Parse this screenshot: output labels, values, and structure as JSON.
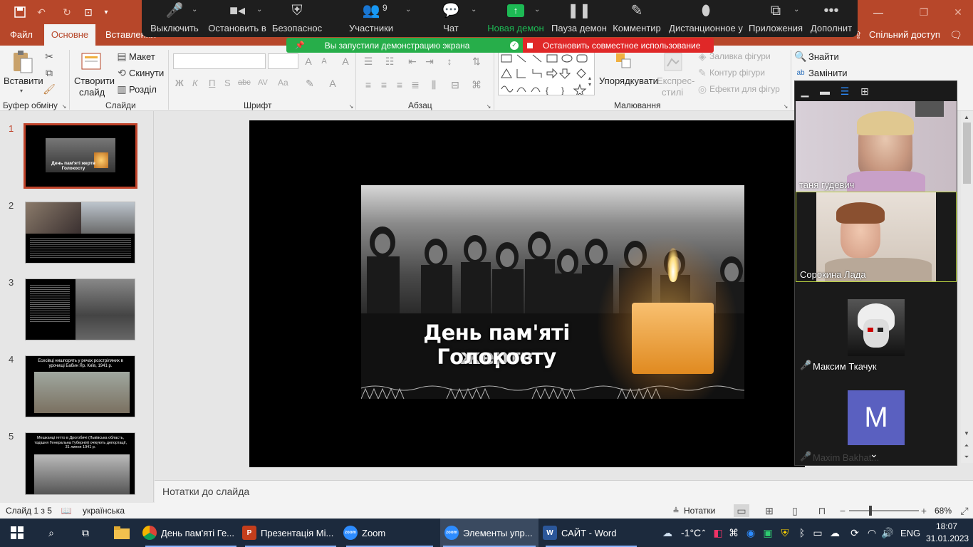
{
  "titlebar": {
    "hidden_right_text": "",
    "window_controls": [
      "minimize-icon",
      "restore-icon",
      "close-icon"
    ]
  },
  "tabs": {
    "file": "Файл",
    "home": "Основне",
    "insert": "Вставлення",
    "share": "Спільний доступ"
  },
  "ribbon": {
    "clipboard": {
      "paste": "Вставити",
      "label": "Буфер обміну"
    },
    "slides": {
      "new_slide": "Створити",
      "new_slide2": "слайд",
      "layout": "Макет",
      "reset": "Скинути",
      "section": "Розділ",
      "label": "Слайди"
    },
    "font": {
      "label": "Шрифт",
      "bold": "Ж",
      "italic": "К",
      "underline": "П",
      "shadow": "S",
      "strike": "abc",
      "spacing": "AV",
      "case": "Aa"
    },
    "paragraph": {
      "label": "Абзац"
    },
    "drawing": {
      "arrange": "Упорядкувати",
      "quick_styles": "Експрес-",
      "quick_styles2": "стилі",
      "fill": "Заливка фігури",
      "outline": "Контур фігури",
      "effects": "Ефекти для фігур",
      "label": "Малювання"
    },
    "editing": {
      "find": "Знайти",
      "replace": "Замінити"
    }
  },
  "zoom_toolbar": {
    "mute": "Выключить",
    "video": "Остановить в",
    "security": "Безопаснос",
    "participants": "Участники",
    "participants_count": "9",
    "chat": "Чат",
    "new_share": "Новая демон",
    "pause_share": "Пауза демон",
    "annotate": "Комментир",
    "remote": "Дистанционное у",
    "apps": "Приложения",
    "more": "Дополнит"
  },
  "share_banner": {
    "sharing": "Вы запустили демонстрацию экрана",
    "stop": "Остановить совместное использование"
  },
  "slides_panel": {
    "thumbs": [
      {
        "num": "1",
        "caption": "День пам'яті жертв Голокосту"
      },
      {
        "num": "2",
        "caption": ""
      },
      {
        "num": "3",
        "caption": ""
      },
      {
        "num": "4",
        "caption": "Есесівці нишпорять у речах розстріляних в урочищі Бабин Яр. Київ, 1941 р."
      },
      {
        "num": "5",
        "caption": "Мешканці гетто в Дрогобичі (Львівська область, тодішня Генеральна Губернія) очікують депортації, 31 липня 1941 р."
      }
    ]
  },
  "slide": {
    "title_line1": "День пам'яті жертв",
    "title_line2": "Голокосту"
  },
  "notes": {
    "placeholder": "Нотатки до слайда"
  },
  "statusbar": {
    "slide_info": "Слайд 1 з 5",
    "language": "українська",
    "notes": "Нотатки",
    "zoom": "68%"
  },
  "gallery": {
    "participants": [
      {
        "name": "таня гудевич"
      },
      {
        "name": "Сорокина Лада"
      },
      {
        "name": "Максим Ткачук"
      },
      {
        "name": "Maxim Bakhat..."
      }
    ],
    "avatar_letter": "M"
  },
  "taskbar": {
    "items": [
      {
        "label": "День пам'яті Ге..."
      },
      {
        "label": "Презентація Mi..."
      },
      {
        "label": "Zoom"
      },
      {
        "label": "Элементы упр..."
      },
      {
        "label": "САЙТ - Word"
      }
    ],
    "weather": "-1°C",
    "lang": "ENG",
    "time": "18:07",
    "date": "31.01.2023"
  },
  "colors": {
    "ppt_accent": "#b7472a",
    "zoom_green": "#1db954",
    "zoom_red": "#e02828"
  }
}
